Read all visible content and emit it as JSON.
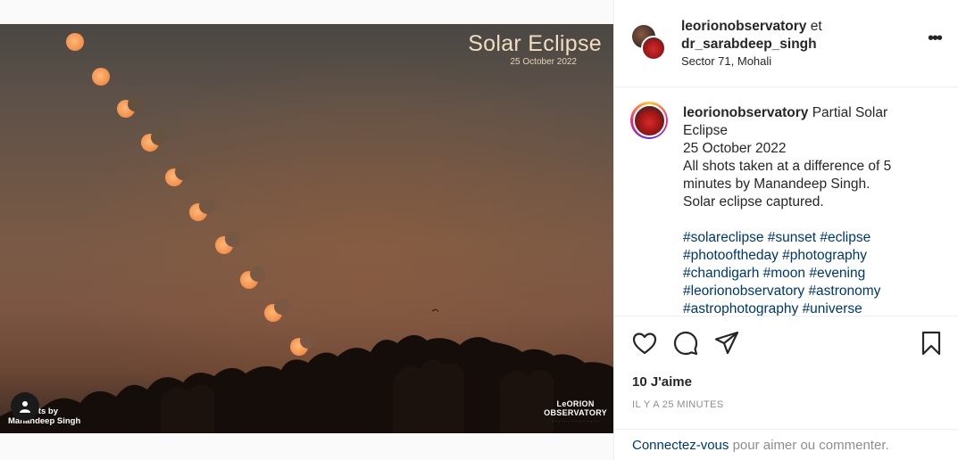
{
  "image": {
    "title": "Solar Eclipse",
    "date": "25 October 2022",
    "credit_line1": "ots by",
    "credit_line2": "Manandeep Singh",
    "logo_line1": "LeORION",
    "logo_line2": "OBSERVATORY"
  },
  "header": {
    "user1": "leorionobservatory",
    "conjunction": "et",
    "user2": "dr_sarabdeep_singh",
    "location": "Sector 71, Mohali",
    "more_icon": "more-horizontal-icon"
  },
  "caption": {
    "username": "leorionobservatory",
    "lines": [
      " Partial Solar Eclipse",
      "25 October 2022",
      "All shots taken at a difference of 5 minutes by Manandeep Singh.",
      "Solar eclipse captured."
    ],
    "hashtags": "#solareclipse #sunset #eclipse #photooftheday #photography #chandigarh #moon #evening #leorionobservatory #astronomy #astrophotography #universe"
  },
  "actions": {
    "like_icon": "heart-icon",
    "comment_icon": "comment-icon",
    "share_icon": "share-icon",
    "save_icon": "bookmark-icon"
  },
  "likes": "10 J'aime",
  "timestamp": "IL Y A 25 MINUTES",
  "login": {
    "link": "Connectez-vous",
    "rest": " pour aimer ou commenter."
  }
}
